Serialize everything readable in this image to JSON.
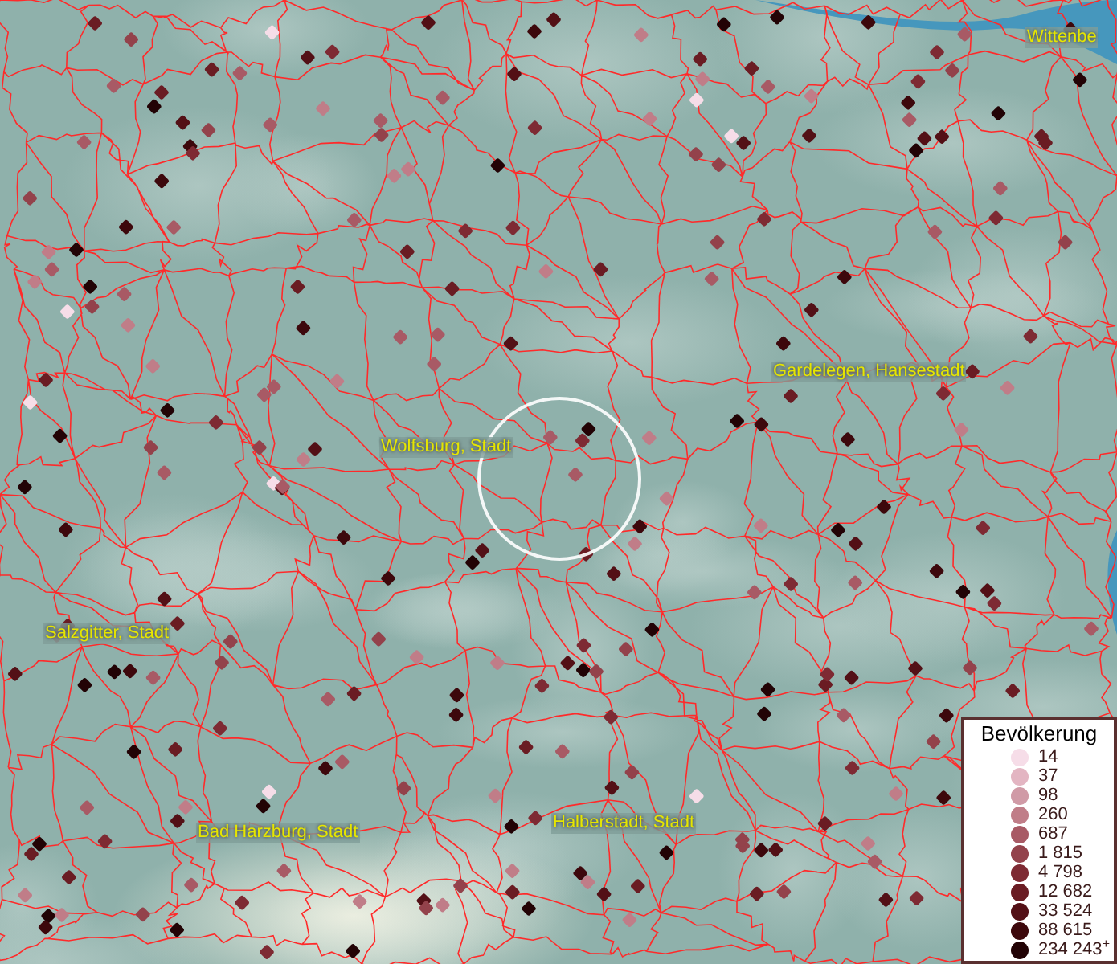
{
  "map_labels": [
    {
      "text": "Wittenbe"
    },
    {
      "text": "Gardelegen, Hansestadt"
    },
    {
      "text": "Wolfsburg, Stadt"
    },
    {
      "text": "Salzgitter, Stadt"
    },
    {
      "text": "Bad Harzburg, Stadt"
    },
    {
      "text": "Halberstadt, Stadt"
    }
  ],
  "legend": {
    "title": "Bevölkerung",
    "items": [
      {
        "label": "14",
        "color": "#f6dde8"
      },
      {
        "label": "37",
        "color": "#e3b5c2"
      },
      {
        "label": "98",
        "color": "#d09aa6"
      },
      {
        "label": "260",
        "color": "#c07d88"
      },
      {
        "label": "687",
        "color": "#a85a65"
      },
      {
        "label": "1 815",
        "color": "#93424b"
      },
      {
        "label": "4 798",
        "color": "#7e2a33"
      },
      {
        "label": "12 682",
        "color": "#6a1c23"
      },
      {
        "label": "33 524",
        "color": "#531016"
      },
      {
        "label": "88 615",
        "color": "#3d080c"
      },
      {
        "label": "234 243$^{+}$",
        "color": "#220305"
      }
    ]
  }
}
